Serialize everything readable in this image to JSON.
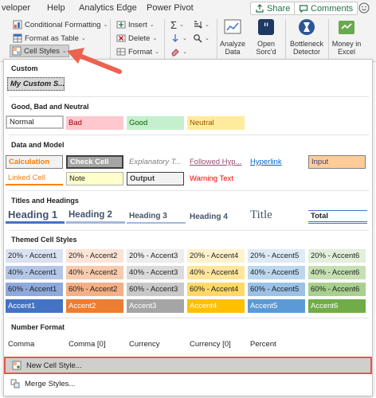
{
  "tabs": [
    "veloper",
    "Help",
    "Analytics Edge",
    "Power Pivot"
  ],
  "tab_buttons": {
    "share": "Share",
    "comments": "Comments"
  },
  "ribbon": {
    "conditional_formatting": "Conditional Formatting",
    "format_as_table": "Format as Table",
    "cell_styles": "Cell Styles",
    "insert": "Insert",
    "delete": "Delete",
    "format": "Format",
    "analyze_data": "Analyze Data",
    "open_sorcd": "Open Sorc'd",
    "bottleneck_detector": "Bottleneck Detector",
    "money_in_excel": "Money in Excel"
  },
  "gallery": {
    "custom": {
      "title": "Custom",
      "cells": [
        "My Custom S..."
      ]
    },
    "good_bad_neutral": {
      "title": "Good, Bad and Neutral",
      "cells": [
        "Normal",
        "Bad",
        "Good",
        "Neutral"
      ]
    },
    "data_model": {
      "title": "Data and Model",
      "row1": [
        "Calculation",
        "Check Cell",
        "Explanatory T...",
        "Followed Hyp...",
        "Hyperlink",
        "Input"
      ],
      "row2": [
        "Linked Cell",
        "Note",
        "Output",
        "Warning Text"
      ]
    },
    "titles_headings": {
      "title": "Titles and Headings",
      "cells": [
        "Heading 1",
        "Heading 2",
        "Heading 3",
        "Heading 4",
        "Title",
        "Total"
      ]
    },
    "themed": {
      "title": "Themed Cell Styles",
      "row20": [
        "20% - Accent1",
        "20% - Accent2",
        "20% - Accent3",
        "20% - Accent4",
        "20% - Accent5",
        "20% - Accent6"
      ],
      "row40": [
        "40% - Accent1",
        "40% - Accent2",
        "40% - Accent3",
        "40% - Accent4",
        "40% - Accent5",
        "40% - Accent6"
      ],
      "row60": [
        "60% - Accent1",
        "60% - Accent2",
        "60% - Accent3",
        "60% - Accent4",
        "60% - Accent5",
        "60% - Accent6"
      ],
      "row100": [
        "Accent1",
        "Accent2",
        "Accent3",
        "Accent4",
        "Accent5",
        "Accent6"
      ]
    },
    "number_format": {
      "title": "Number Format",
      "cells": [
        "Comma",
        "Comma [0]",
        "Currency",
        "Currency [0]",
        "Percent"
      ]
    },
    "new_cell_style": "New Cell Style...",
    "merge_styles": "Merge Styles..."
  },
  "colors": {
    "accent1": "#4472c4",
    "accent2": "#ed7d31",
    "accent3": "#a5a5a5",
    "accent4": "#ffc000",
    "accent5": "#5b9bd5",
    "accent6": "#70ad47",
    "highlight_border": "#e4594a",
    "arrow": "#ec6150",
    "excel_green": "#217346"
  }
}
